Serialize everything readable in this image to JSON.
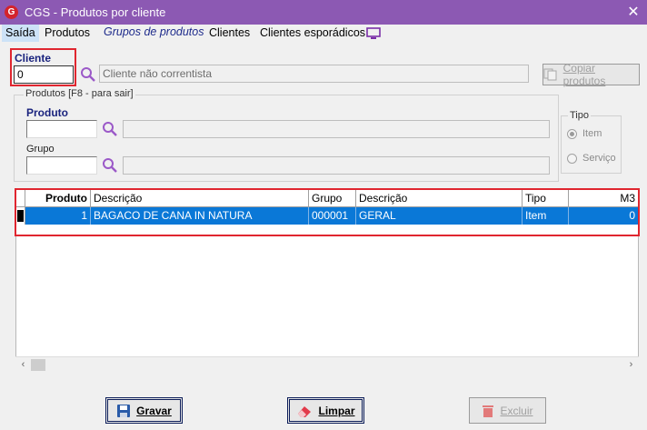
{
  "window": {
    "app_logo": "G",
    "title": "CGS - Produtos por cliente",
    "close_glyph": "✕"
  },
  "menu": {
    "items": [
      {
        "label": "Saída"
      },
      {
        "label": "Produtos"
      },
      {
        "label": "Grupos de produtos"
      },
      {
        "label": "Clientes"
      },
      {
        "label": "Clientes esporádicos"
      }
    ],
    "monitor_icon": "monitor-icon"
  },
  "cliente": {
    "label": "Cliente",
    "value": "0",
    "name_placeholder": "Cliente não correntista",
    "copy_button": "Copiar produtos"
  },
  "produtos_group": {
    "title": "Produtos [F8 - para sair]",
    "produto_label": "Produto",
    "produto_value": "",
    "produto_desc": "",
    "grupo_label": "Grupo",
    "grupo_value": "",
    "grupo_desc": "",
    "tipo": {
      "title": "Tipo",
      "options": [
        {
          "label": "Item",
          "checked": true
        },
        {
          "label": "Serviço",
          "checked": false
        }
      ]
    }
  },
  "grid": {
    "columns": [
      "Produto",
      "Descrição",
      "Grupo",
      "Descrição",
      "Tipo",
      "M3"
    ],
    "rows": [
      [
        "1",
        "BAGACO DE CANA IN NATURA",
        "000001",
        "GERAL",
        "Item",
        "0"
      ]
    ]
  },
  "buttons": {
    "gravar": "Gravar",
    "limpar": "Limpar",
    "excluir": "Excluir"
  },
  "colors": {
    "titlebar": "#8c59b3",
    "selection": "#0a78d7",
    "highlight_box": "#e0262f",
    "label_blue": "#1a237e"
  }
}
